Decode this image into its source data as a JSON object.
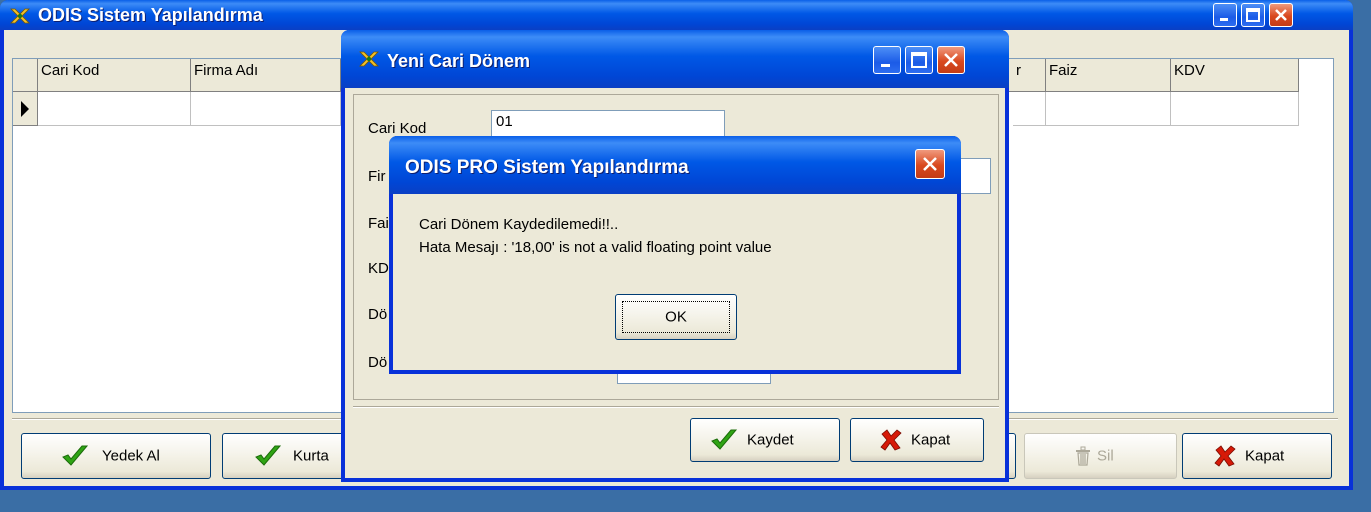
{
  "main_window": {
    "title": "ODIS Sistem Yapılandırma",
    "columns": [
      "Cari Kod",
      "Firma Adı",
      "",
      "r",
      "Faiz",
      "KDV"
    ],
    "buttons": {
      "backup": "Yedek Al",
      "restore": "Kurta",
      "delete": "Sil",
      "close": "Kapat"
    }
  },
  "dialog": {
    "title": "Yeni Cari Dönem",
    "fields": {
      "cari_kod": {
        "label": "Cari Kod",
        "value": "01"
      },
      "firma": {
        "label": "Fir",
        "value": ""
      },
      "faiz": {
        "label": "Fai"
      },
      "kdv": {
        "label": "KD"
      },
      "donem1": {
        "label": "Dö"
      },
      "donem2": {
        "label": "Dö"
      }
    },
    "buttons": {
      "save": "Kaydet",
      "close": "Kapat"
    }
  },
  "message_box": {
    "title": "ODIS PRO Sistem Yapılandırma",
    "line1": "Cari Dönem Kaydedilemedi!!..",
    "line2": "Hata Mesajı : '18,00' is not a valid floating point value",
    "ok": "OK"
  },
  "colors": {
    "title_bar": "#0054e3",
    "window_face": "#ece9d8",
    "close_button": "#d9491f",
    "check_green": "#2fa414",
    "x_red": "#d61a08"
  }
}
